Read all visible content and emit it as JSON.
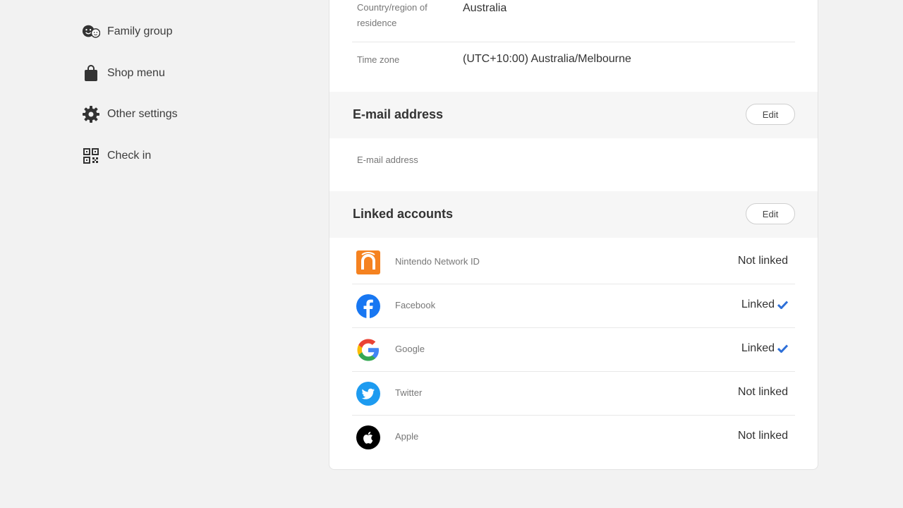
{
  "sidebar": {
    "items": [
      {
        "label": "Family group",
        "icon": "family-group-icon"
      },
      {
        "label": "Shop menu",
        "icon": "shopping-bag-icon"
      },
      {
        "label": "Other settings",
        "icon": "gear-icon"
      },
      {
        "label": "Check in",
        "icon": "qr-code-icon"
      }
    ]
  },
  "profile": {
    "country_label": "Country/region of residence",
    "country_label_line1": "Country/region of",
    "country_label_line2": "residence",
    "country_value": "Australia",
    "timezone_label": "Time zone",
    "timezone_value": "(UTC+10:00) Australia/Melbourne"
  },
  "email_section": {
    "title": "E-mail address",
    "edit_label": "Edit",
    "field_label": "E-mail address"
  },
  "linked_section": {
    "title": "Linked accounts",
    "edit_label": "Edit",
    "accounts": [
      {
        "name": "Nintendo Network ID",
        "status": "Not linked",
        "icon": "nintendo-network-icon"
      },
      {
        "name": "Facebook",
        "status": "Linked",
        "icon": "facebook-icon"
      },
      {
        "name": "Google",
        "status": "Linked",
        "icon": "google-icon"
      },
      {
        "name": "Twitter",
        "status": "Not linked",
        "icon": "twitter-icon"
      },
      {
        "name": "Apple",
        "status": "Not linked",
        "icon": "apple-icon"
      }
    ]
  },
  "colors": {
    "background": "#f2f2f2",
    "card": "#ffffff",
    "section_header": "#f6f6f6",
    "linked_check": "#2d6fd8",
    "nintendo": "#f58220",
    "facebook": "#1877f2",
    "twitter": "#1d9bf0"
  }
}
